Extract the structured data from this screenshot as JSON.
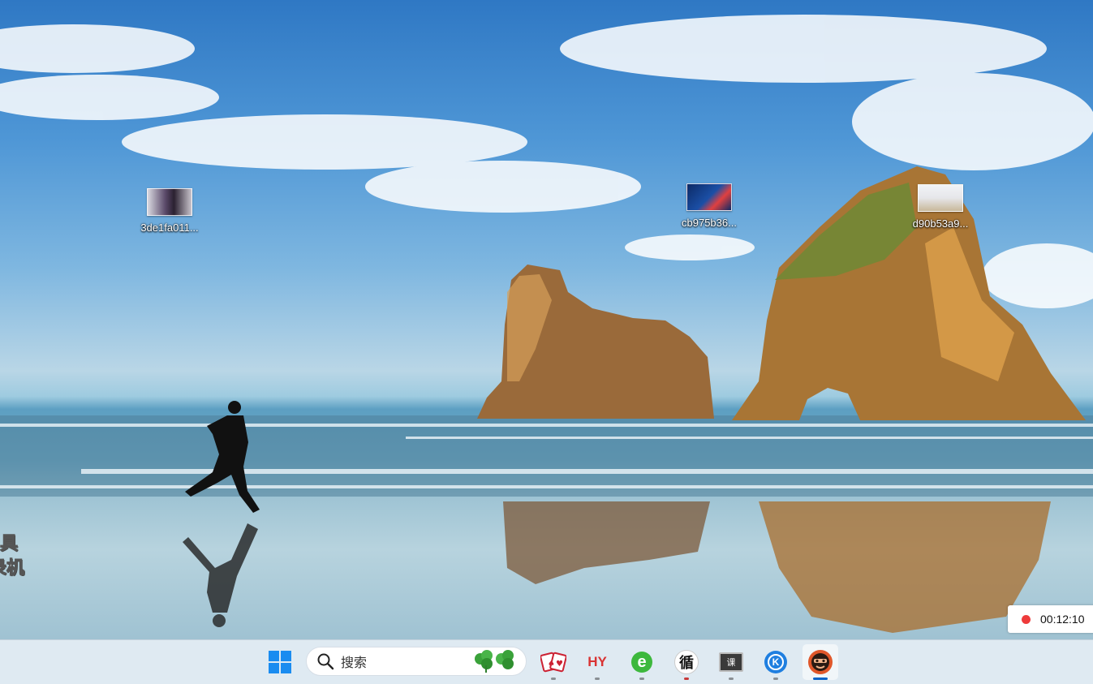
{
  "desktop": {
    "icons": [
      {
        "label": "3de1fa011...",
        "icon": "image-file-icon"
      },
      {
        "label": "cb975b36...",
        "icon": "image-file-icon"
      },
      {
        "label": "d90b53a9...",
        "icon": "image-file-icon"
      }
    ],
    "side_text_line1": "具",
    "side_text_line2": "录机"
  },
  "recorder": {
    "time": "00:12:10",
    "status_color": "#ee3b3b"
  },
  "taskbar": {
    "search_placeholder": "搜索",
    "apps": [
      {
        "name": "start",
        "icon": "windows-start-icon"
      },
      {
        "name": "solitaire",
        "icon": "solitaire-cards-icon"
      },
      {
        "name": "hy",
        "icon": "hy-app-icon",
        "glyph": "HY"
      },
      {
        "name": "browser",
        "icon": "ie-browser-icon",
        "glyph": "e"
      },
      {
        "name": "calligraphy",
        "icon": "calligraphy-app-icon",
        "glyph": "循"
      },
      {
        "name": "course",
        "icon": "course-app-icon",
        "glyph": "课"
      },
      {
        "name": "k-app",
        "icon": "k-app-icon",
        "glyph": "K"
      },
      {
        "name": "recorder-app",
        "icon": "recorder-app-icon"
      }
    ],
    "accent": "#0a64c8"
  }
}
